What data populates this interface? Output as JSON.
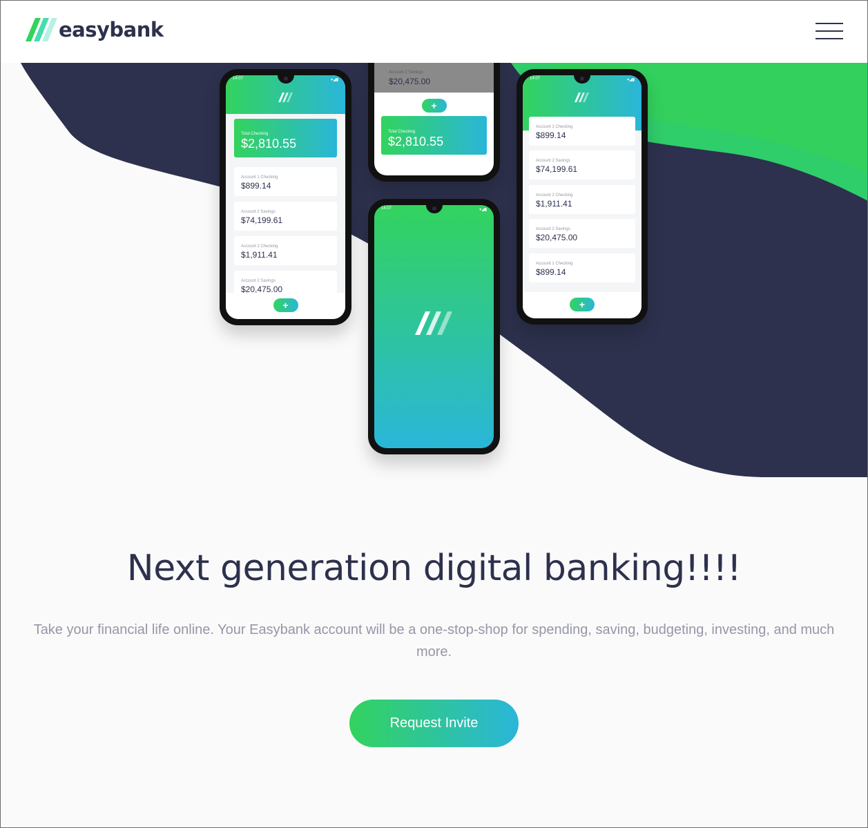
{
  "brand": {
    "name": "easybank"
  },
  "nav": {
    "menu_icon": "hamburger-menu-icon"
  },
  "colors": {
    "dark_blue": "#2d314d",
    "lime_green": "#33d35e",
    "bright_cyan": "#2ab6d9",
    "grayish_blue": "#9597a6",
    "page_bg": "#fafafa"
  },
  "hero": {
    "headline": "Next generation digital banking!!!!",
    "subcopy": "Take your financial life online. Your Easybank account will be a one-stop-shop for spending, saving, budgeting, investing, and much more.",
    "cta_label": "Request Invite"
  },
  "phones": {
    "status_time": "14:07",
    "status_icons": "▾◢▮",
    "fab_symbol": "+",
    "left": {
      "total_label": "Total Checking",
      "total_amount": "$2,810.55",
      "accounts": [
        {
          "label": "Account 1 Checking",
          "amount": "$899.14"
        },
        {
          "label": "Account 2 Savings",
          "amount": "$74,199.61"
        },
        {
          "label": "Account 2 Checking",
          "amount": "$1,911.41"
        },
        {
          "label": "Account 2 Savings",
          "amount": "$20,475.00"
        }
      ]
    },
    "top_middle": {
      "label": "Account 2 Savings",
      "amount": "$20,475.00",
      "total_label": "Total Checking",
      "total_amount": "$2,810.55"
    },
    "right": {
      "accounts": [
        {
          "label": "Account 1 Checking",
          "amount": "$899.14"
        },
        {
          "label": "Account 2 Savings",
          "amount": "$74,199.61"
        },
        {
          "label": "Account 2 Checking",
          "amount": "$1,911.41"
        },
        {
          "label": "Account 2 Savings",
          "amount": "$20,475.00"
        },
        {
          "label": "Account 1 Checking",
          "amount": "$899.14"
        }
      ]
    }
  }
}
